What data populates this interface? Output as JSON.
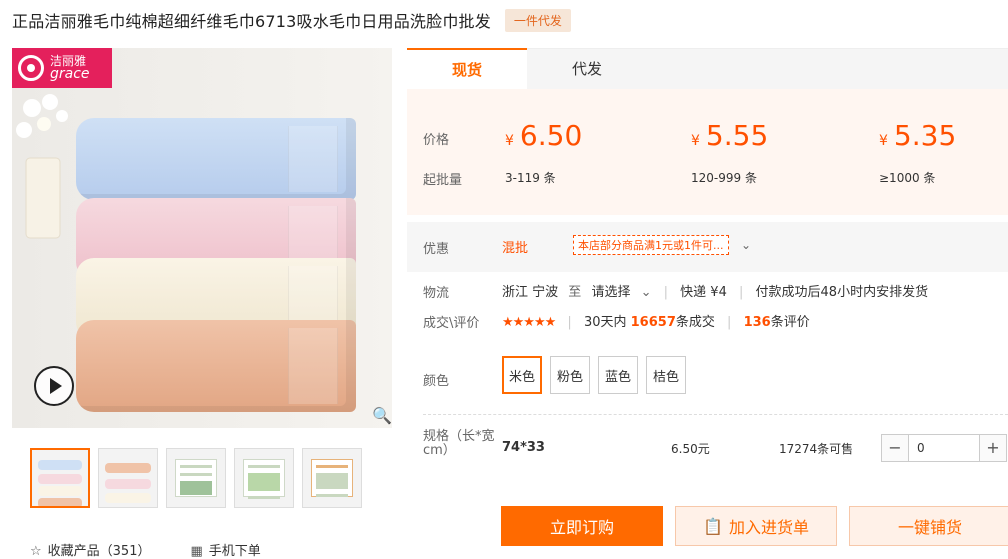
{
  "header": {
    "title": "正品洁丽雅毛巾纯棉超细纤维毛巾6713吸水毛巾日用品洗脸巾批发",
    "badge": "一件代发"
  },
  "gallery": {
    "logo_cn": "洁丽雅",
    "logo_en": "grace",
    "thumbs": 5
  },
  "tabs": [
    "现货",
    "代发"
  ],
  "price": {
    "label": "价格",
    "batch_label": "起批量",
    "currency": "¥",
    "tiers": [
      {
        "price": "6.50",
        "range": "3-119 条"
      },
      {
        "price": "5.55",
        "range": "120-999 条"
      },
      {
        "price": "5.35",
        "range": "≥1000 条"
      }
    ]
  },
  "promo": {
    "label": "优惠",
    "tag": "混批",
    "text": "本店部分商品满1元或1件可..."
  },
  "logistics": {
    "label": "物流",
    "origin": "浙江 宁波",
    "to": "至",
    "dest": "请选择",
    "express": "快递 ¥4",
    "ship": "付款成功后48小时内安排发货"
  },
  "reviews": {
    "label": "成交\\评价",
    "stars": "★★★★★",
    "period": "30天内",
    "sold": "16657",
    "sold_suffix": "条成交",
    "count": "136",
    "count_suffix": "条评价"
  },
  "color": {
    "label": "颜色",
    "options": [
      "米色",
      "粉色",
      "蓝色",
      "桔色"
    ]
  },
  "spec": {
    "label": "规格（长*宽cm）",
    "value": "74*33",
    "price": "6.50元",
    "stock": "17274条可售",
    "qty": "0"
  },
  "actions": {
    "buy": "立即订购",
    "cart": "加入进货单",
    "ship": "一键铺货"
  },
  "footer": {
    "fav": "收藏产品（351）",
    "mobile": "手机下单"
  }
}
